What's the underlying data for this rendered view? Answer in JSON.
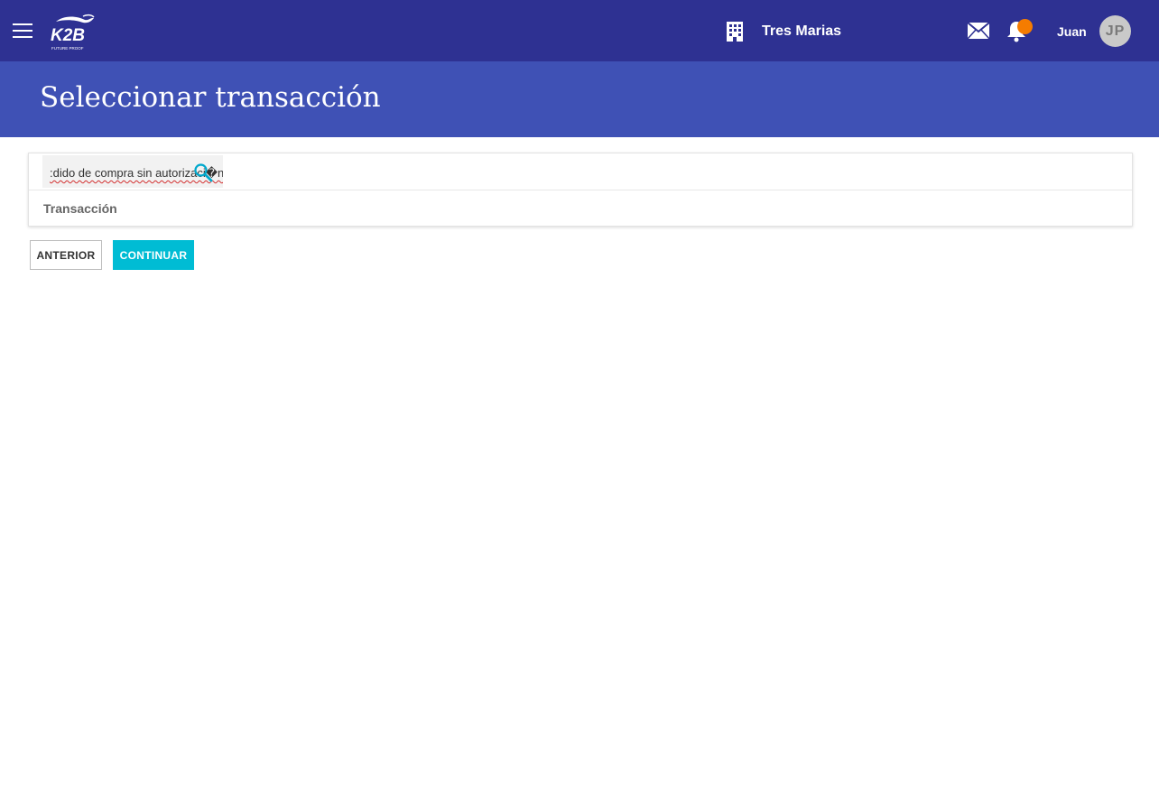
{
  "header": {
    "logo_text": "K2B",
    "logo_tagline": "FUTURE PROOF",
    "company_name": "Tres Marias",
    "user_name": "Juan",
    "user_initials": "JP",
    "notification_color": "#f57c00",
    "brand_color": "#2e3192",
    "icons": [
      "menu-icon",
      "building-icon",
      "mail-icon",
      "bell-icon"
    ]
  },
  "page": {
    "title": "Seleccionar transacción",
    "title_band_color": "#3f51b5"
  },
  "search": {
    "value": ":dido de compra sin autorizaci�n",
    "icon": "search-icon"
  },
  "table": {
    "columns": [
      "Transacción"
    ],
    "rows": []
  },
  "actions": {
    "previous_label": "ANTERIOR",
    "continue_label": "CONTINUAR",
    "continue_color": "#00bcd4"
  }
}
